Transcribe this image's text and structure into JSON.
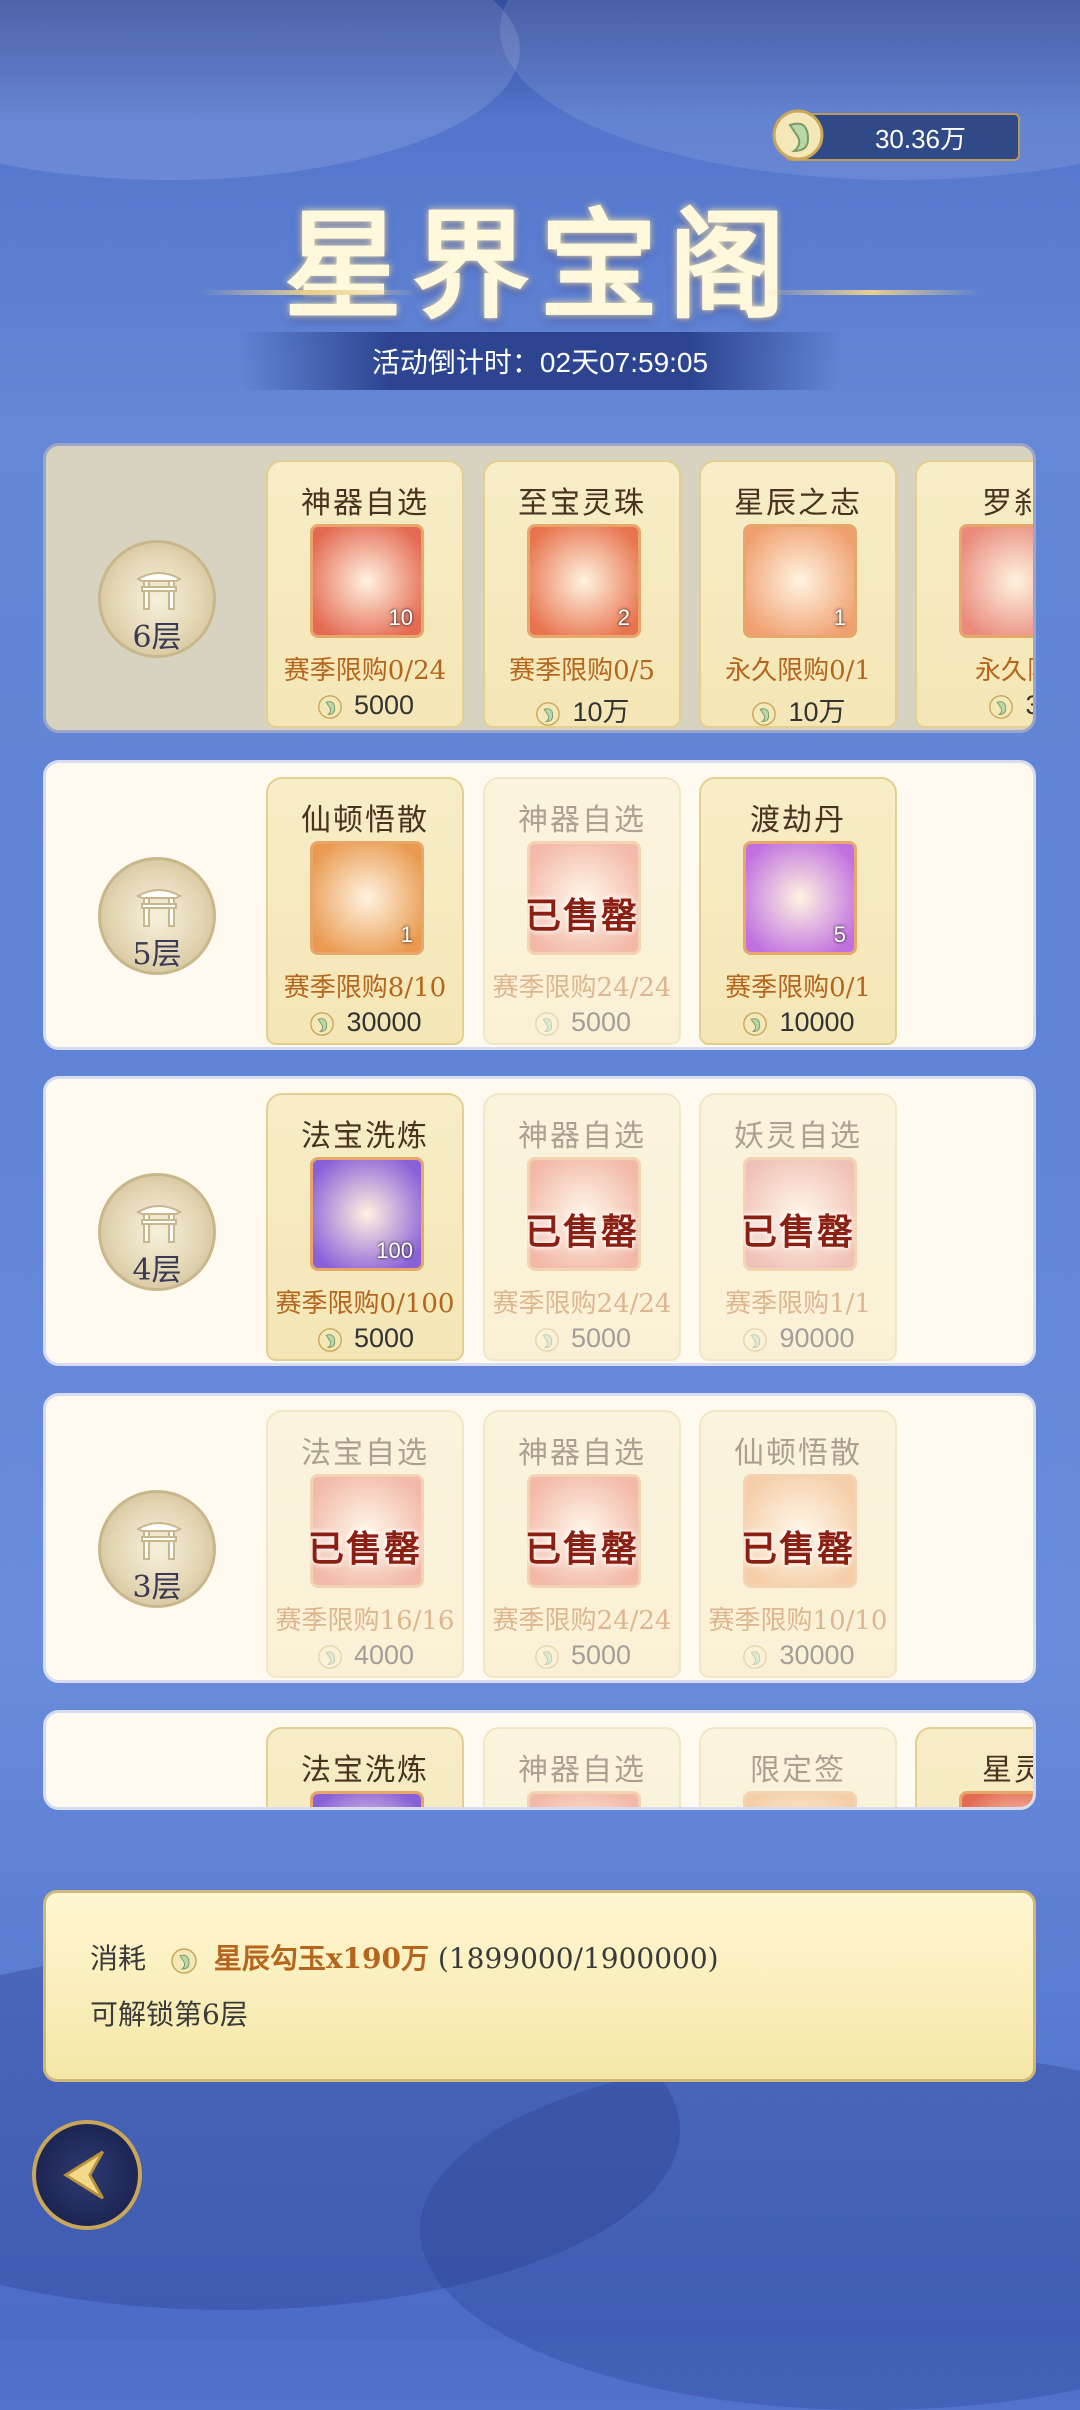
{
  "header": {
    "currency_value": "30.36万",
    "title": "星界宝阁",
    "countdown": "活动倒计时：02天07:59:05"
  },
  "tiers": [
    {
      "label": "6层",
      "locked": true,
      "items": [
        {
          "name": "神器自选",
          "qty": "10",
          "limit": "赛季限购0/24",
          "price": "5000",
          "sold": false,
          "color": "#e46a52"
        },
        {
          "name": "至宝灵珠",
          "qty": "2",
          "limit": "赛季限购0/5",
          "price": "10万",
          "sold": false,
          "color": "#e7744e"
        },
        {
          "name": "星辰之志",
          "qty": "1",
          "limit": "永久限购0/1",
          "price": "10万",
          "sold": false,
          "color": "#f0a070"
        },
        {
          "name": "罗刹",
          "qty": "",
          "limit": "永久限",
          "price": "3",
          "sold": false,
          "color": "#e98a7c"
        }
      ]
    },
    {
      "label": "5层",
      "locked": false,
      "items": [
        {
          "name": "仙顿悟散",
          "qty": "1",
          "limit": "赛季限购8/10",
          "price": "30000",
          "sold": false,
          "color": "#e99a50"
        },
        {
          "name": "神器自选",
          "qty": "",
          "limit": "赛季限购24/24",
          "price": "5000",
          "sold": true,
          "color": "#e46a52"
        },
        {
          "name": "渡劫丹",
          "qty": "5",
          "limit": "赛季限购0/1",
          "price": "10000",
          "sold": false,
          "color": "#c070e0"
        }
      ]
    },
    {
      "label": "4层",
      "locked": false,
      "items": [
        {
          "name": "法宝洗炼",
          "qty": "100",
          "limit": "赛季限购0/100",
          "price": "5000",
          "sold": false,
          "color": "#8a60d8"
        },
        {
          "name": "神器自选",
          "qty": "",
          "limit": "赛季限购24/24",
          "price": "5000",
          "sold": true,
          "color": "#e46a52"
        },
        {
          "name": "妖灵自选",
          "qty": "",
          "limit": "赛季限购1/1",
          "price": "90000",
          "sold": true,
          "color": "#e07f74"
        }
      ]
    },
    {
      "label": "3层",
      "locked": false,
      "items": [
        {
          "name": "法宝自选",
          "qty": "",
          "limit": "赛季限购16/16",
          "price": "4000",
          "sold": true,
          "color": "#e46a52"
        },
        {
          "name": "神器自选",
          "qty": "",
          "limit": "赛季限购24/24",
          "price": "5000",
          "sold": true,
          "color": "#e46a52"
        },
        {
          "name": "仙顿悟散",
          "qty": "",
          "limit": "赛季限购10/10",
          "price": "30000",
          "sold": true,
          "color": "#e99a50"
        }
      ]
    },
    {
      "label": "",
      "locked": false,
      "items": [
        {
          "name": "法宝洗炼",
          "qty": "",
          "limit": "",
          "price": "",
          "sold": false,
          "color": "#8a60d8"
        },
        {
          "name": "神器自选",
          "qty": "",
          "limit": "",
          "price": "",
          "sold": true,
          "color": "#e46a52"
        },
        {
          "name": "限定签",
          "qty": "",
          "limit": "",
          "price": "",
          "sold": true,
          "color": "#e99a50"
        },
        {
          "name": "星灵",
          "qty": "",
          "limit": "",
          "price": "",
          "sold": false,
          "color": "#e46a52"
        }
      ]
    }
  ],
  "sold_text": "已售罄",
  "cost": {
    "prefix": "消耗",
    "item": "星辰勾玉x190万",
    "progress": "(1899000/1900000)",
    "unlock": "可解锁第6层"
  },
  "colors": {
    "accent": "#b5651d",
    "panel_border": "#d9dcf0",
    "bg": "#5f83d6"
  }
}
